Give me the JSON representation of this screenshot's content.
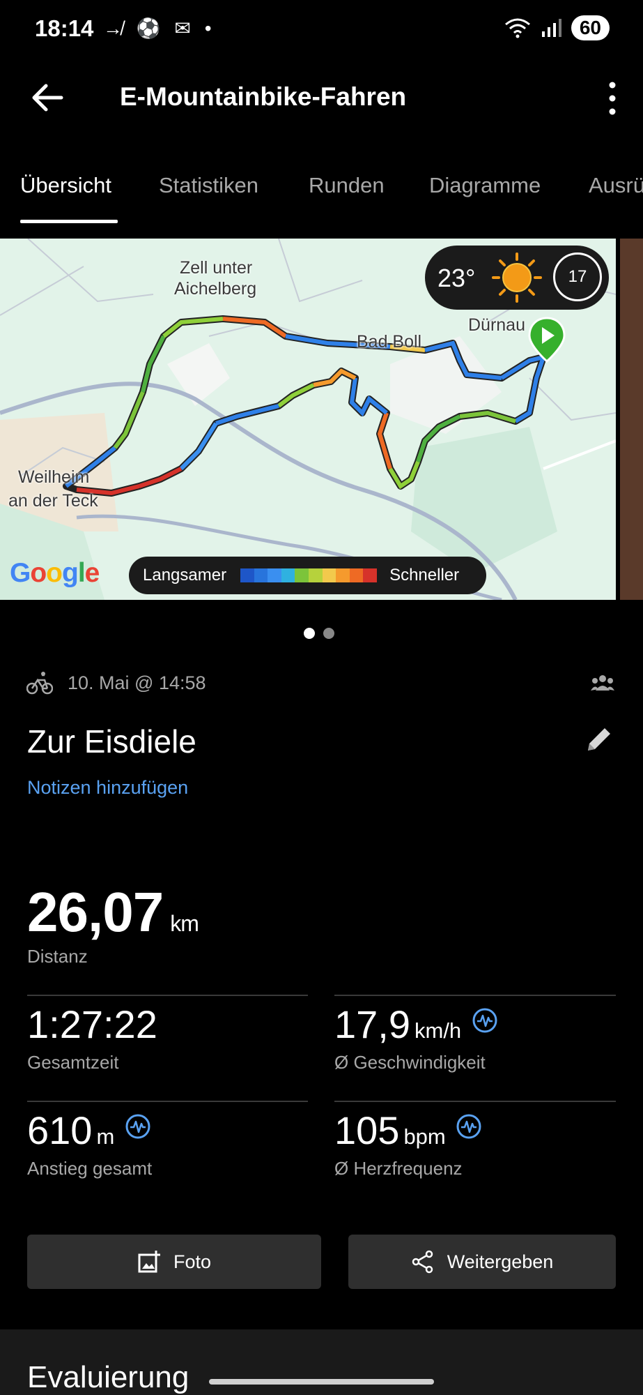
{
  "status_bar": {
    "time": "18:14",
    "left_icons": [
      "missed-call-icon",
      "soccer-icon",
      "mail-icon",
      "dot-icon"
    ],
    "right_icons": [
      "wifi-icon",
      "signal-icon"
    ],
    "battery": "60"
  },
  "header": {
    "title": "E-Mountainbike-Fahren"
  },
  "tabs": [
    {
      "label": "Übersicht",
      "active": true
    },
    {
      "label": "Statistiken",
      "active": false
    },
    {
      "label": "Runden",
      "active": false
    },
    {
      "label": "Diagramme",
      "active": false
    },
    {
      "label": "Ausrü",
      "active": false
    }
  ],
  "map": {
    "weather": {
      "temperature": "23°",
      "wind": "17"
    },
    "places": [
      "Zell unter",
      "Aichelberg",
      "Bad Boll",
      "Dürnau",
      "Weilheim",
      "an der Teck"
    ],
    "legend": {
      "slow_label": "Langsamer",
      "fast_label": "Schneller",
      "colors": [
        "#1e56c8",
        "#2874dc",
        "#3a8ff0",
        "#2fb1e0",
        "#7cc43a",
        "#b6d23c",
        "#f2c94c",
        "#f59a2d",
        "#ee6a24",
        "#d6322a"
      ]
    },
    "attribution": "Google"
  },
  "pager": {
    "count": 2,
    "active": 0
  },
  "activity": {
    "date": "10. Mai @ 14:58",
    "name": "Zur Eisdiele",
    "notes_link": "Notizen hinzufügen"
  },
  "stats": {
    "distance": {
      "value": "26,07",
      "unit": "km",
      "label": "Distanz"
    },
    "total_time": {
      "value": "1:27:22",
      "label": "Gesamtzeit"
    },
    "avg_speed": {
      "value": "17,9",
      "unit": "km/h",
      "label": "Ø Geschwindigkeit"
    },
    "ascent": {
      "value": "610",
      "unit": "m",
      "label": "Anstieg gesamt"
    },
    "avg_hr": {
      "value": "105",
      "unit": "bpm",
      "label": "Ø Herzfrequenz"
    }
  },
  "buttons": {
    "photo": "Foto",
    "share": "Weitergeben"
  },
  "bottom_section": {
    "title": "Evaluierung"
  },
  "colors": {
    "accent_link": "#5aa2f2",
    "background": "#000000",
    "button_bg": "#2f2f2f"
  }
}
